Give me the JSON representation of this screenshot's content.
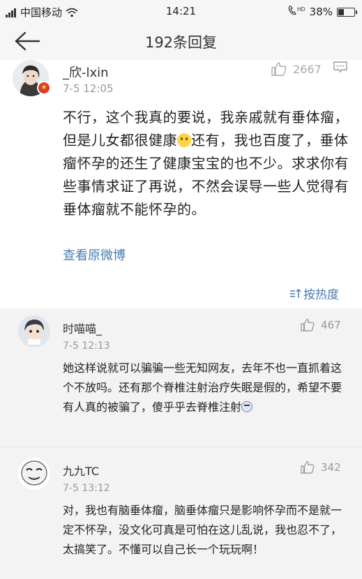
{
  "status_bar": {
    "carrier": "中国移动",
    "time": "14:21",
    "network": "HD",
    "battery_percent": "38%",
    "battery_level": 0.38
  },
  "nav": {
    "title": "192条回复"
  },
  "main_comment": {
    "username": "_欣-lxin",
    "time": "7-5 12:05",
    "likes": "2667",
    "text_before_emoji": "不行，这个我真的要说，我亲戚就有垂体瘤，但是儿女都很健康",
    "text_after_emoji": "还有，我也百度了，垂体瘤怀孕的还生了健康宝宝的也不少。求求你有些事情求证了再说，不然会误导一些人觉得有垂体瘤就不能怀孕的。",
    "view_original": "查看原微博",
    "sort_label": "按热度"
  },
  "replies": [
    {
      "username": "时喵喵_",
      "time": "7-5 12:13",
      "likes": "467",
      "text": "她这样说就可以骗骗一些无知网友，去年不也一直抓着这个不放吗。还有那个脊椎注射治疗失眠是假的，希望不要有人真的被骗了，傻乎乎去脊椎注射"
    },
    {
      "username": "九九TC",
      "time": "7-5 13:12",
      "likes": "342",
      "text": "对，我也有脑垂体瘤，脑垂体瘤只是影响怀孕而不是就一定不怀孕，没文化可真是可怕在这儿乱说，我也忍不了，太搞笑了。不懂可以自己长一个玩玩啊！"
    }
  ],
  "colors": {
    "link": "#4a7cb0",
    "reply_bg": "#f3f3f3",
    "header_bg": "#f6f6f6",
    "badge": "#e03a2a"
  }
}
